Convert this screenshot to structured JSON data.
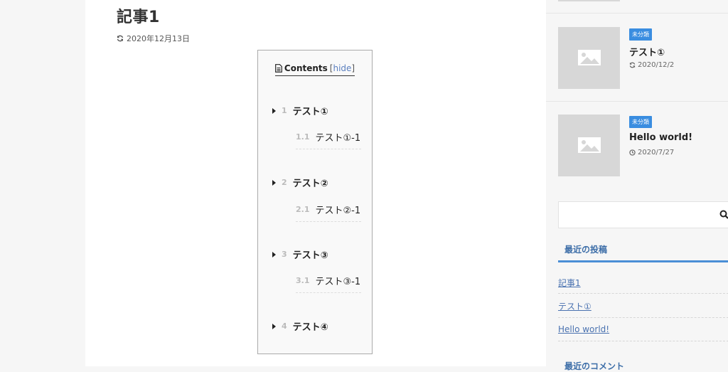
{
  "article": {
    "title": "記事1",
    "updated": "2020年12月13日"
  },
  "toc": {
    "heading": "Contents",
    "hide_open": "[",
    "hide_label": "hide",
    "hide_close": "]",
    "items": [
      {
        "num": "1",
        "label": "テスト①",
        "sub": {
          "num": "1.1",
          "label": "テスト①-1"
        }
      },
      {
        "num": "2",
        "label": "テスト②",
        "sub": {
          "num": "2.1",
          "label": "テスト②-1"
        }
      },
      {
        "num": "3",
        "label": "テスト③",
        "sub": {
          "num": "3.1",
          "label": "テスト③-1"
        }
      },
      {
        "num": "4",
        "label": "テスト④"
      }
    ]
  },
  "sidebar": {
    "posts": [
      {
        "category": "未分類",
        "title": "テスト①",
        "date": "2020/12/2",
        "date_icon": "refresh-icon"
      },
      {
        "category": "未分類",
        "title": "Hello world!",
        "date": "2020/7/27",
        "date_icon": "clock-icon"
      }
    ],
    "recent_posts_title": "最近の投稿",
    "recent_posts": [
      "記事1",
      "テスト①",
      "Hello world!"
    ],
    "recent_comments_title": "最近のコメント"
  },
  "colors": {
    "accent": "#3a8de0",
    "link": "#4a72b0"
  }
}
